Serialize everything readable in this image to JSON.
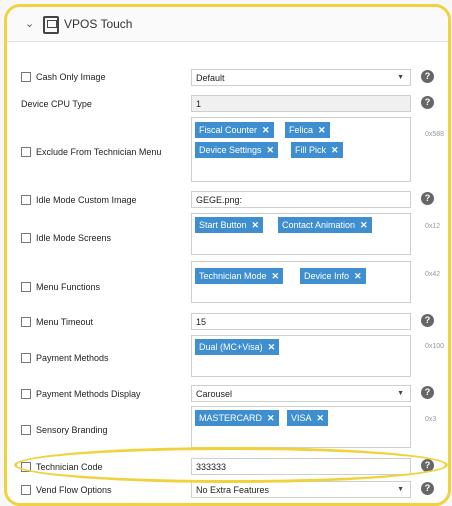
{
  "panel": {
    "title": "VPOS Touch"
  },
  "rows": {
    "cash_only_image": {
      "label": "Cash Only Image",
      "value": "Default"
    },
    "device_cpu_type": {
      "label": "Device CPU Type",
      "value": "1"
    },
    "exclude_from_technician_menu": {
      "label": "Exclude From Technician Menu",
      "tags": [
        "Fiscal Counter",
        "Felica",
        "Device Settings",
        "Fill Pick"
      ],
      "hex": "0x588"
    },
    "idle_mode_custom_image": {
      "label": "Idle Mode Custom Image",
      "value": "GEGE.png:"
    },
    "idle_mode_screens": {
      "label": "Idle Mode Screens",
      "tags": [
        "Start Button",
        "Contact Animation"
      ],
      "hex": "0x12"
    },
    "menu_functions": {
      "label": "Menu Functions",
      "tags": [
        "Technician Mode",
        "Device Info"
      ],
      "hex": "0x42"
    },
    "menu_timeout": {
      "label": "Menu Timeout",
      "value": "15"
    },
    "payment_methods": {
      "label": "Payment Methods",
      "tags": [
        "Dual (MC+Visa)"
      ],
      "hex": "0x100"
    },
    "payment_methods_display": {
      "label": "Payment Methods Display",
      "value": "Carousel"
    },
    "sensory_branding": {
      "label": "Sensory Branding",
      "tags": [
        "MASTERCARD",
        "VISA"
      ],
      "hex": "0x3"
    },
    "technician_code": {
      "label": "Technician Code",
      "value": "333333"
    },
    "vend_flow_options": {
      "label": "Vend Flow Options",
      "value": "No Extra Features"
    }
  },
  "icons": {
    "help": "?",
    "tag_remove": "✕",
    "dropdown_caret": "▼",
    "collapse_chevron": "⌄"
  },
  "colors": {
    "highlight": "#f2d23c",
    "tag": "#3f8fd0"
  }
}
